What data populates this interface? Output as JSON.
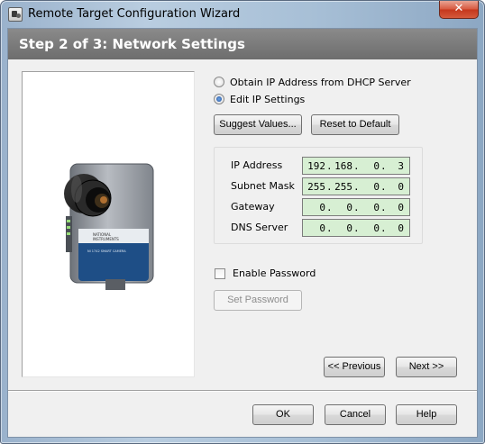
{
  "window": {
    "title": "Remote Target Configuration Wizard",
    "close_glyph": "✕"
  },
  "header": {
    "step_title": "Step 2 of 3: Network Settings"
  },
  "network": {
    "dhcp_label": "Obtain IP Address from DHCP Server",
    "dhcp_selected": false,
    "edit_label": "Edit IP Settings",
    "edit_selected": true,
    "suggest_label": "Suggest Values...",
    "reset_label": "Reset to Default",
    "fields": [
      {
        "label": "IP Address",
        "octets": [
          "192",
          "168",
          "0",
          "3"
        ]
      },
      {
        "label": "Subnet Mask",
        "octets": [
          "255",
          "255",
          "0",
          "0"
        ]
      },
      {
        "label": "Gateway",
        "octets": [
          "0",
          "0",
          "0",
          "0"
        ]
      },
      {
        "label": "DNS Server",
        "octets": [
          "0",
          "0",
          "0",
          "0"
        ]
      }
    ],
    "field_bg_color": "#d7efd3"
  },
  "password": {
    "enable_label": "Enable Password",
    "enabled": false,
    "set_label": "Set Password"
  },
  "camera": {
    "brand_line1": "NATIONAL",
    "brand_line2": "INSTRUMENTS",
    "model_text": "NI 1742 SMART CAMERA"
  },
  "nav": {
    "previous_label": "<< Previous",
    "next_label": "Next >>"
  },
  "footer": {
    "ok_label": "OK",
    "cancel_label": "Cancel",
    "help_label": "Help"
  }
}
